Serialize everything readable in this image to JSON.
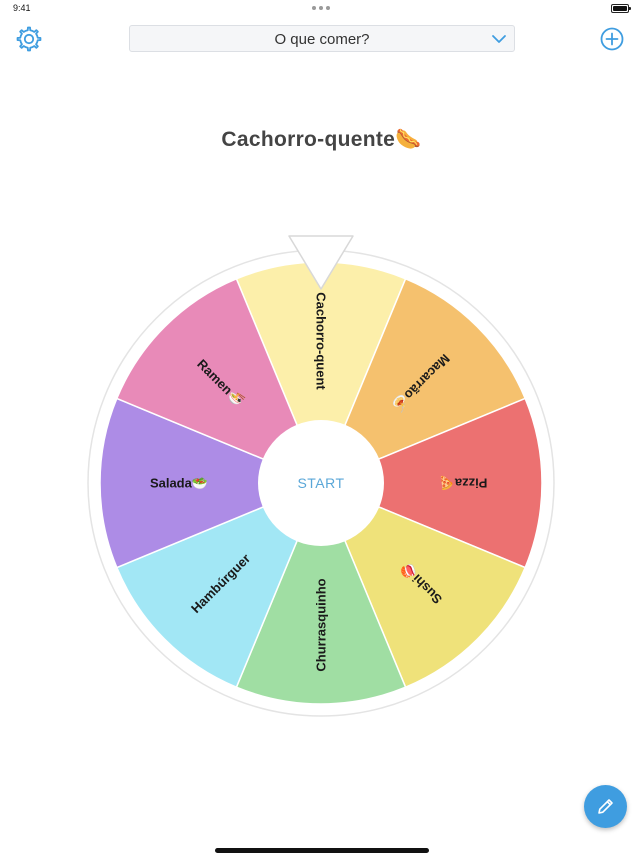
{
  "status_bar": {
    "time": "9:41"
  },
  "header": {
    "wheel_selector": {
      "value": "O que comer?",
      "icon": "chevron-down-icon"
    },
    "settings_icon": "gear-icon",
    "add_icon": "plus-circle-icon"
  },
  "result": {
    "text": "Cachorro-quente🌭"
  },
  "wheel": {
    "start_label": "START",
    "segments": [
      {
        "label": "Cachorro-quent",
        "color": "#fcefaa"
      },
      {
        "label": "Macarrão🍝",
        "color": "#f5c16e"
      },
      {
        "label": "Pizza🍕",
        "color": "#ec7171"
      },
      {
        "label": "Sushi🍣",
        "color": "#efe27a"
      },
      {
        "label": "Churrasquinho",
        "color": "#a0dea3"
      },
      {
        "label": "Hambúrguer",
        "color": "#a2e7f5"
      },
      {
        "label": "Salada🥗",
        "color": "#ad8ce6"
      },
      {
        "label": "Ramen🍜",
        "color": "#e88ab8"
      }
    ]
  },
  "fab": {
    "icon": "pencil-icon"
  }
}
